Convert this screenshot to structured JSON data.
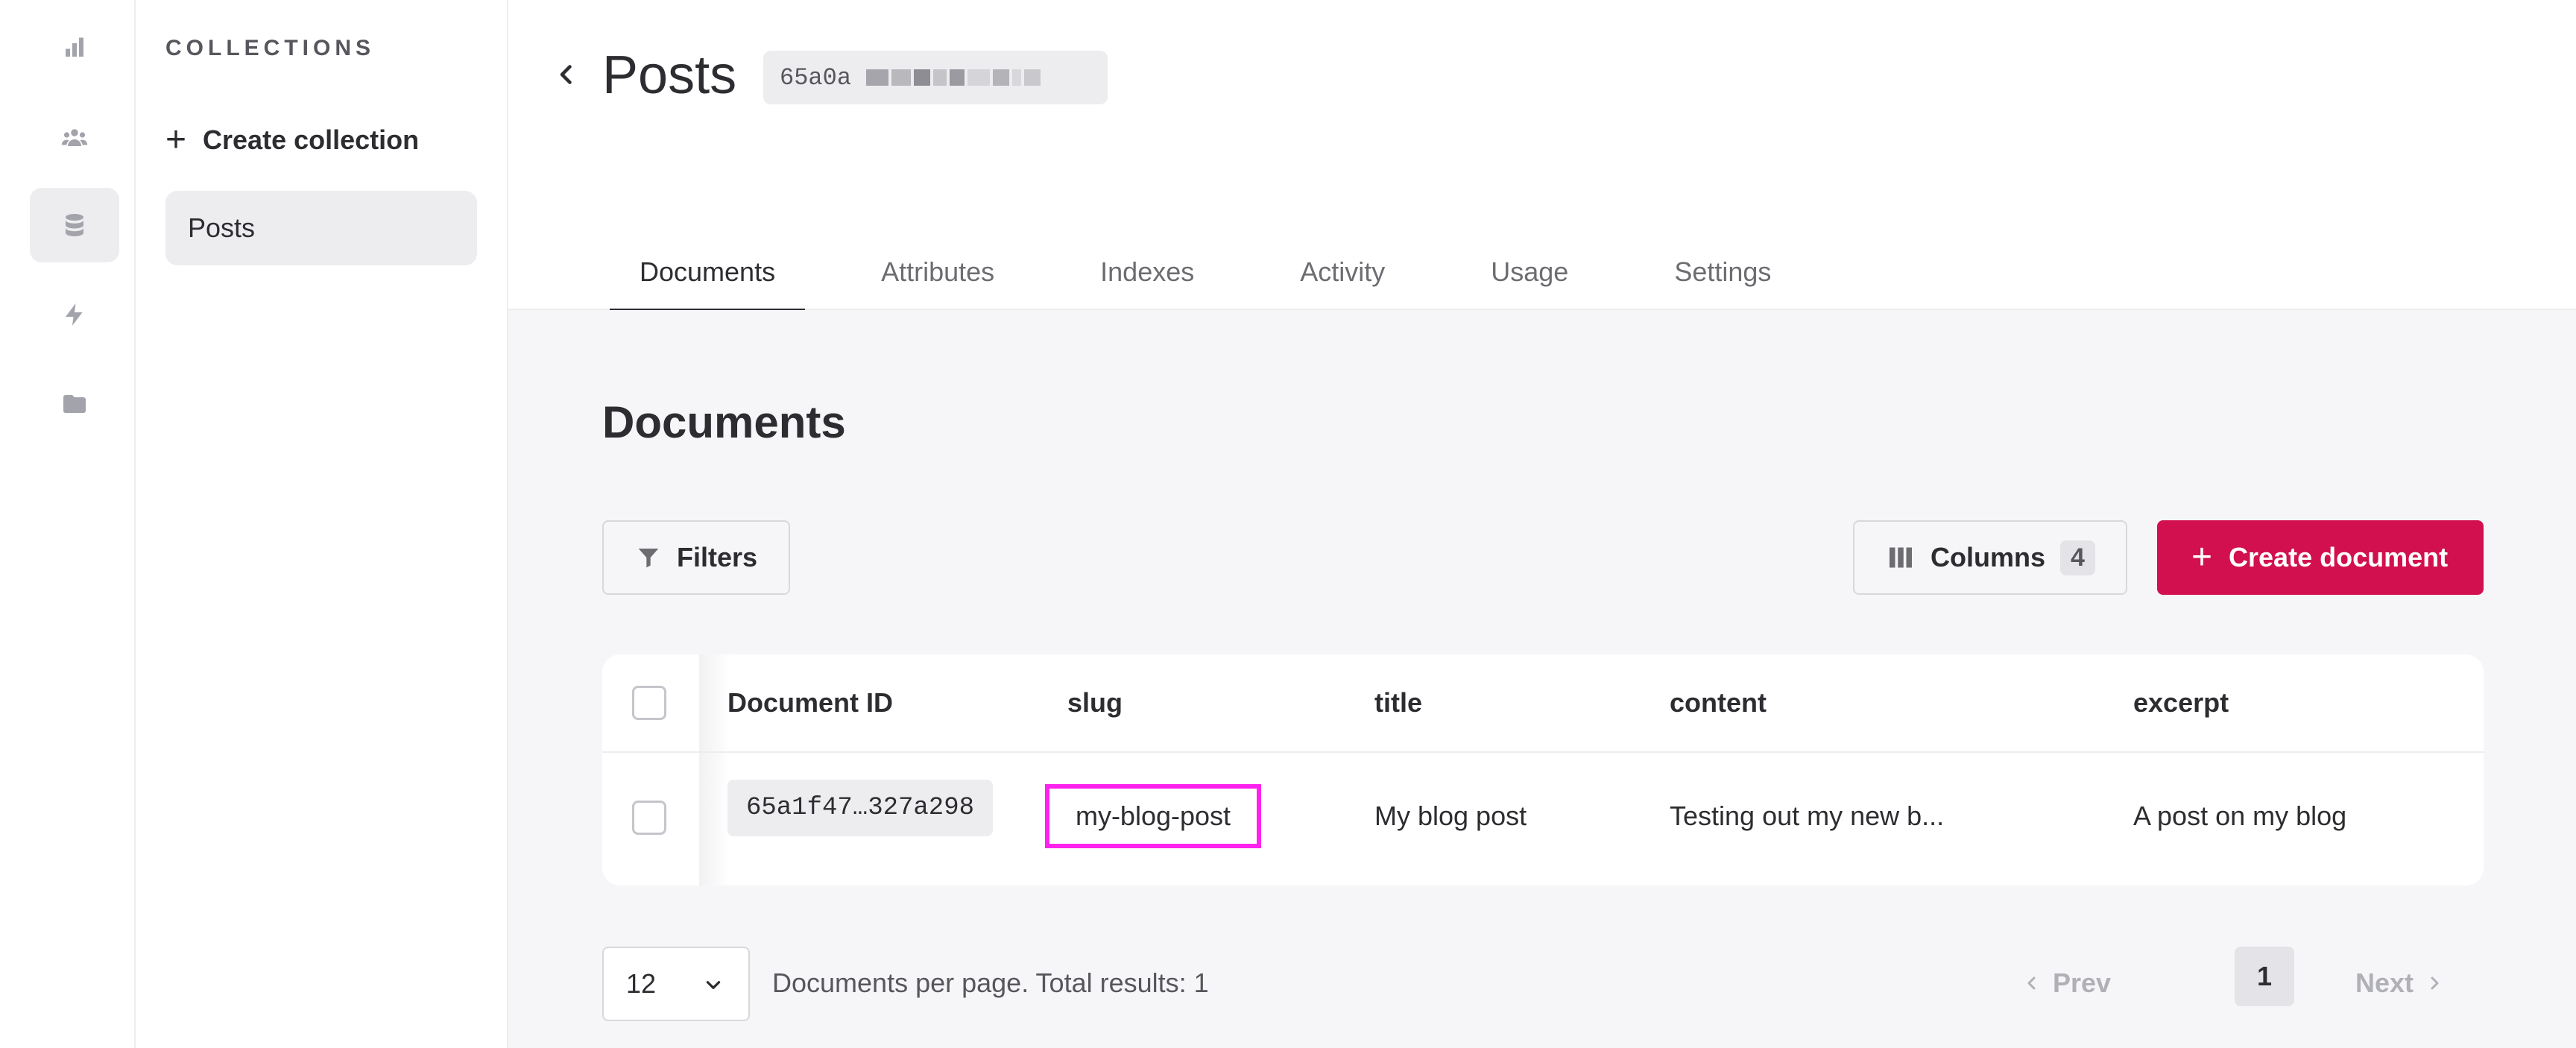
{
  "nav_rail": {
    "items": [
      {
        "icon": "bar-chart-icon"
      },
      {
        "icon": "users-icon"
      },
      {
        "icon": "database-icon",
        "active": true
      },
      {
        "icon": "lightning-icon"
      },
      {
        "icon": "folder-icon"
      }
    ]
  },
  "collections_panel": {
    "title": "COLLECTIONS",
    "create_label": "Create collection",
    "items": [
      {
        "label": "Posts",
        "active": true
      }
    ]
  },
  "header": {
    "title": "Posts",
    "id_chip": "65a0a",
    "tabs": [
      "Documents",
      "Attributes",
      "Indexes",
      "Activity",
      "Usage",
      "Settings"
    ],
    "active_tab": "Documents"
  },
  "documents": {
    "section_title": "Documents",
    "filters_label": "Filters",
    "columns_label": "Columns",
    "columns_count": "4",
    "create_label": "Create document",
    "columns": [
      "Document ID",
      "slug",
      "title",
      "content",
      "excerpt"
    ],
    "rows": [
      {
        "id": "65a1f47…327a298",
        "slug": "my-blog-post",
        "title": "My blog post",
        "content": "Testing out my new b...",
        "excerpt": "A post on my blog"
      }
    ]
  },
  "pagination": {
    "page_size": "12",
    "summary": "Documents per page. Total results: 1",
    "prev_label": "Prev",
    "next_label": "Next",
    "current_page": "1"
  },
  "colors": {
    "accent": "#d2104f",
    "highlight": "#ff22ee",
    "background": "#f6f6f8"
  }
}
